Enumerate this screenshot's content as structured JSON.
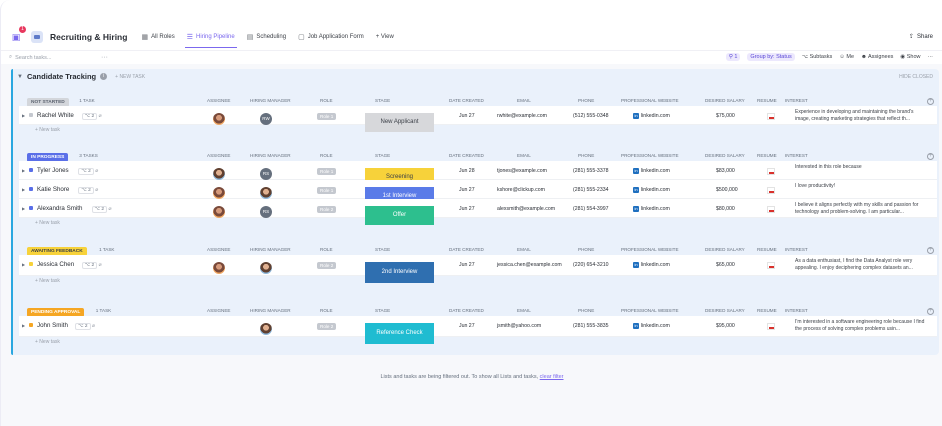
{
  "header": {
    "title": "Recruiting & Hiring",
    "notif_count": "1",
    "views": [
      {
        "label": "All Roles",
        "icon": "▦"
      },
      {
        "label": "Hiring Pipeline",
        "icon": "☰"
      },
      {
        "label": "Scheduling",
        "icon": "▤"
      },
      {
        "label": "Job Application Form",
        "icon": "▢"
      },
      {
        "label": "+ View",
        "icon": ""
      }
    ],
    "share_label": "Share"
  },
  "toolbar": {
    "search_placeholder": "Search tasks...",
    "more": "···",
    "filter_count": "1",
    "group_by": "Group by: Status",
    "subtasks": "Subtasks",
    "me": "Me",
    "assignees": "Assignees",
    "show": "Show",
    "more2": "···"
  },
  "list": {
    "title": "Candidate Tracking",
    "new_task": "+ NEW TASK",
    "hide_closed": "HIDE CLOSED",
    "columns": {
      "assignee": "ASSIGNEE",
      "manager": "HIRING MANAGER",
      "role": "ROLE",
      "stage": "STAGE",
      "date": "DATE CREATED",
      "email": "EMAIL",
      "phone": "PHONE",
      "website": "PROFESSIONAL WEBSITE",
      "salary": "DESIRED SALARY",
      "resume": "RESUME",
      "interest": "INTEREST"
    },
    "add_task": "+ New task"
  },
  "groups": [
    {
      "status": "NOT STARTED",
      "count": "1 TASK",
      "color": "#d3d6db",
      "text_color": "#5c6370",
      "rows": [
        {
          "name": "Rachel White",
          "subtasks": "2",
          "manager": "RW",
          "role": "Role 1",
          "stage": "New Applicant",
          "stage_color": "#d7d8db",
          "stage_text": "#3b3f46",
          "date": "Jun 27",
          "email": "rwhite@example.com",
          "phone": "(512) 555-0348",
          "website": "linkedin.com",
          "salary": "$75,000",
          "interest": "Experience in developing and maintaining the brand's image, creating marketing strategies that reflect th..."
        }
      ]
    },
    {
      "status": "IN PROGRESS",
      "count": "3 TASKS",
      "color": "#5a6fe8",
      "text_color": "#ffffff",
      "rows": [
        {
          "name": "Tyler Jones",
          "subtasks": "2",
          "manager": "RS",
          "role": "Role 1",
          "stage": "Screening",
          "stage_color": "#f7d23a",
          "stage_text": "#3b3f46",
          "date": "Jun 28",
          "email": "tjones@example.com",
          "phone": "(281) 555-3378",
          "website": "linkedin.com",
          "salary": "$83,000",
          "interest": "Interested in this role because"
        },
        {
          "name": "Katie Shore",
          "subtasks": "2",
          "manager": "",
          "role": "Role 1",
          "stage": "1st Interview",
          "stage_color": "#5a7be8",
          "stage_text": "#ffffff",
          "date": "Jun 27",
          "email": "kshore@clickup.com",
          "phone": "(281) 555-2334",
          "website": "linkedin.com",
          "salary": "$500,000",
          "interest": "I love productivity!"
        },
        {
          "name": "Alexandra Smith",
          "subtasks": "2",
          "manager": "RS",
          "role": "Role 2",
          "stage": "Offer",
          "stage_color": "#2dbf8e",
          "stage_text": "#ffffff",
          "date": "Jun 27",
          "email": "alexsmith@example.com",
          "phone": "(281) 554-3997",
          "website": "linkedin.com",
          "salary": "$80,000",
          "interest": "I believe it aligns perfectly with my skills and passion for technology and problem-solving. I am particular..."
        }
      ]
    },
    {
      "status": "AWAITING FEEDBACK",
      "count": "1 TASK",
      "color": "#f7d23a",
      "text_color": "#3b3f46",
      "rows": [
        {
          "name": "Jessica Chen",
          "subtasks": "2",
          "manager": "",
          "role": "Role 2",
          "stage": "2nd Interview",
          "stage_color": "#2f6fb0",
          "stage_text": "#ffffff",
          "date": "Jun 27",
          "email": "jessica.chen@example.com",
          "phone": "(220) 654-3210",
          "website": "linkedin.com",
          "salary": "$65,000",
          "interest": "As a data enthusiast, I find the Data Analyst role very appealing. I enjoy deciphering complex datasets an..."
        }
      ]
    },
    {
      "status": "PENDING APPROVAL",
      "count": "1 TASK",
      "color": "#f5a623",
      "text_color": "#ffffff",
      "rows": [
        {
          "name": "John Smith",
          "subtasks": "2",
          "manager": "",
          "role": "Role 2",
          "stage": "Reference Check",
          "stage_color": "#1fbcd1",
          "stage_text": "#ffffff",
          "date": "Jun 27",
          "email": "jsmith@yahoo.com",
          "phone": "(281) 555-3835",
          "website": "linkedin.com",
          "salary": "$95,000",
          "interest": "I'm interested in a software engineering role because I find the process of solving complex problems usin..."
        }
      ]
    }
  ],
  "footer": {
    "message": "Lists and tasks are being filtered out. To show all Lists and tasks,",
    "link": "clear filter"
  }
}
